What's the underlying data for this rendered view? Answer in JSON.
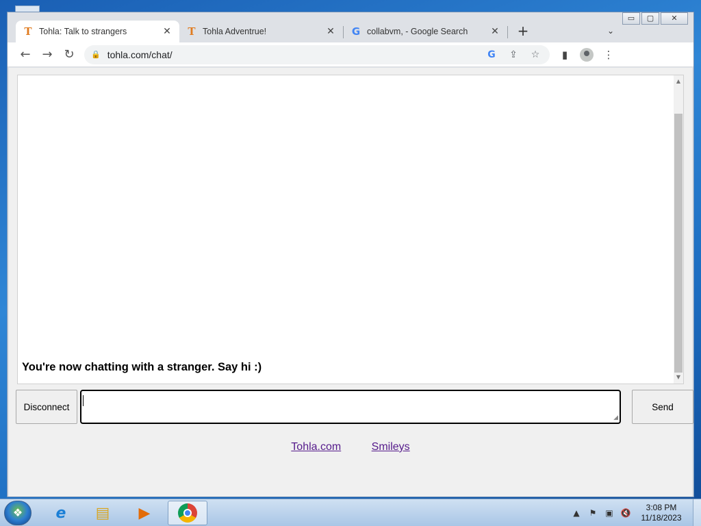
{
  "browser": {
    "tabs": [
      {
        "title": "Tohla: Talk to strangers",
        "favicon": "T",
        "active": true
      },
      {
        "title": "Tohla Adventrue!",
        "favicon": "T",
        "active": false
      },
      {
        "title": "collabvm, - Google Search",
        "favicon": "G",
        "active": false
      }
    ],
    "url": "tohla.com/chat/",
    "icons": {
      "back": "←",
      "forward": "→",
      "reload": "↻",
      "lock": "🔒",
      "google": "G",
      "share": "⇪",
      "star": "☆",
      "sidepanel": "▮",
      "menu": "⋮",
      "newtab": "+",
      "tabsearch": "⌄",
      "tabclose": "✕"
    },
    "window_controls": {
      "minimize": "▭",
      "maximize": "▢",
      "close": "✕"
    }
  },
  "chat": {
    "status_message": "You're now chatting with a stranger. Say hi :)",
    "input_value": "",
    "disconnect_label": "Disconnect",
    "send_label": "Send",
    "links": [
      {
        "label": "Tohla.com"
      },
      {
        "label": "Smileys"
      }
    ]
  },
  "taskbar": {
    "time": "3:08 PM",
    "date": "11/18/2023",
    "tray_icons": [
      "▲",
      "⚑",
      "▣",
      "🔇"
    ]
  },
  "colors": {
    "link": "#551a8b",
    "tohla_orange": "#e07b1f",
    "page_bg": "#f0f0f0"
  }
}
